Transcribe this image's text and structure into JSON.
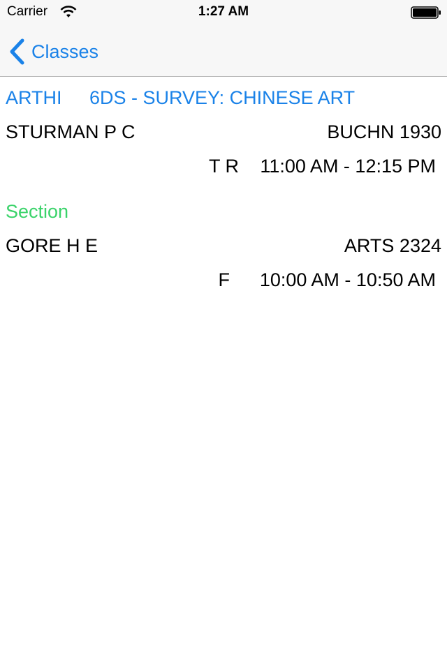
{
  "status_bar": {
    "carrier": "Carrier",
    "time": "1:27 AM",
    "wifi_icon": "wifi-icon",
    "battery_icon": "battery-icon"
  },
  "nav": {
    "back_label": "Classes",
    "back_icon": "chevron-left-icon",
    "tint_color": "#1a82e8"
  },
  "course": {
    "department": "ARTHI",
    "title": "6DS - SURVEY: CHINESE ART",
    "instructor": "STURMAN P C",
    "location": "BUCHN 1930",
    "days": "T R",
    "time": "11:00 AM - 12:15 PM"
  },
  "section": {
    "header": "Section",
    "header_color": "#3ad36a",
    "instructor": "GORE H E",
    "location": "ARTS 2324",
    "days": "F",
    "time": "10:00 AM - 10:50 AM"
  }
}
